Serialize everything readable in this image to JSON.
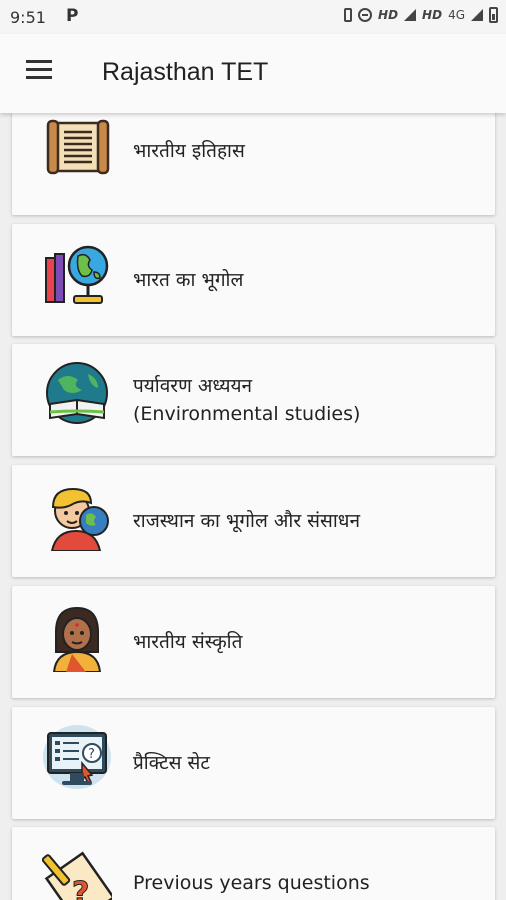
{
  "status": {
    "time": "9:51",
    "network1": "HD",
    "network2": "HD",
    "network_type": "4G"
  },
  "appbar": {
    "title": "Rajasthan TET"
  },
  "topics": [
    {
      "label": "भारतीय इतिहास",
      "icon": "scroll-icon"
    },
    {
      "label": "भारत का भूगोल",
      "icon": "globe-books-icon"
    },
    {
      "label": "पर्यावरण अध्ययन",
      "sublabel": "(Environmental studies)",
      "icon": "earth-book-icon"
    },
    {
      "label": "राजस्थान का भूगोल और संसाधन",
      "icon": "boy-globe-icon"
    },
    {
      "label": "भारतीय संस्कृति",
      "icon": "indian-woman-icon"
    },
    {
      "label": "प्रैक्टिस सेट",
      "icon": "computer-test-icon"
    },
    {
      "label": "Previous years questions",
      "icon": "question-paper-icon"
    }
  ]
}
